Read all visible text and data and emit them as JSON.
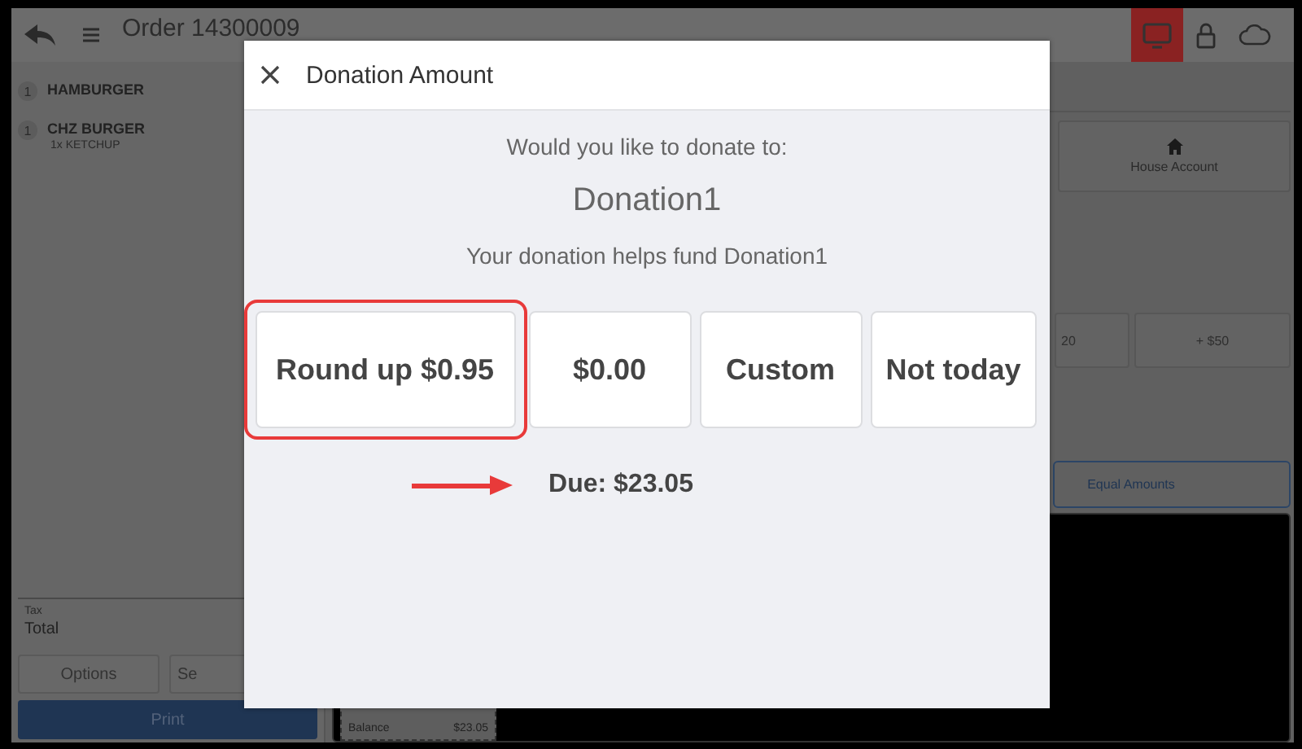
{
  "header": {
    "title": "Order 14300009"
  },
  "order_items": [
    {
      "qty": "1",
      "name": "HAMBURGER"
    },
    {
      "qty": "1",
      "name": "CHZ BURGER",
      "modifiers": [
        "1x KETCHUP"
      ]
    }
  ],
  "totals": {
    "tax_label": "Tax",
    "total_label": "Total"
  },
  "left_buttons": [
    "Options",
    "Se"
  ],
  "print_button": "Print",
  "tiles": {
    "house_account": "House Account",
    "quick_amounts": [
      "20",
      "+ $50"
    ],
    "equal_amounts": "Equal Amounts"
  },
  "receipt": {
    "label": "Balance",
    "amount": "$23.05"
  },
  "dialog": {
    "title": "Donation Amount",
    "prompt": "Would you like to donate to:",
    "charity": "Donation1",
    "note": "Your donation helps fund Donation1",
    "options": [
      {
        "label": "Round up $0.95",
        "selected": true
      },
      {
        "label": "$0.00",
        "selected": false
      },
      {
        "label": "Custom",
        "selected": false
      },
      {
        "label": "Not today",
        "selected": false
      }
    ],
    "due": "Due: $23.05"
  }
}
